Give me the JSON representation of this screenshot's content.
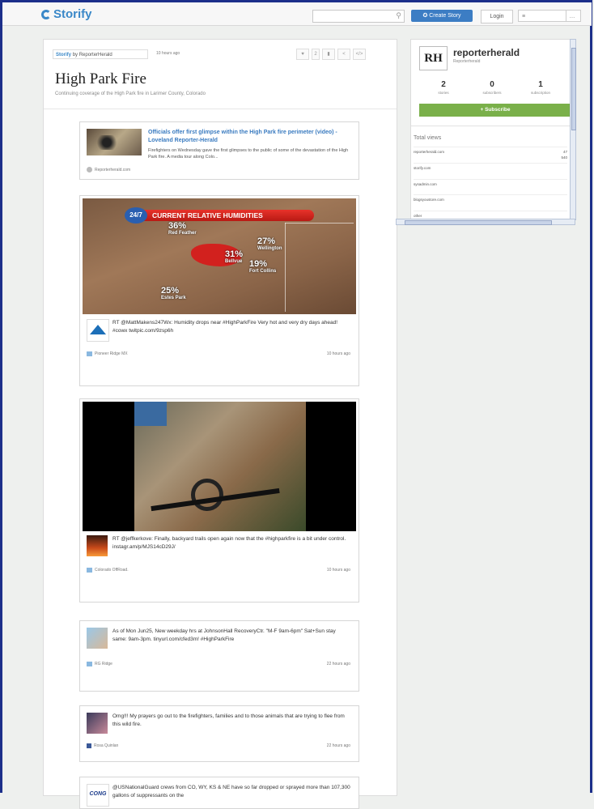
{
  "header": {
    "logo": "Storify",
    "search_placeholder": "",
    "create_label": "Create Story",
    "login_label": "Login",
    "lang_value": "≡"
  },
  "story": {
    "byline_brand": "Storify",
    "byline_by": "by ReporterHerald",
    "time_ago": "10 hours ago",
    "like_count": "2",
    "title": "High Park Fire",
    "subtitle": "Continuing coverage of the High Park fire in Larimer County, Colorado"
  },
  "cards": {
    "link": {
      "title": "Officials offer first glimpse within the High Park fire perimeter (video) - Loveland Reporter-Herald",
      "description": "Firefighters on Wednesday gave the first glimpses to the public of some of the devastation of the High Park fire. A media tour along Colo...",
      "source": "Reporterherald.com"
    },
    "map": {
      "banner": "CURRENT RELATIVE HUMIDITIES",
      "logo": "24/7",
      "labels": [
        {
          "n": "36%",
          "p": "Red Feather"
        },
        {
          "n": "27%",
          "p": "Wellington"
        },
        {
          "n": "31%",
          "p": "Bellvue"
        },
        {
          "n": "19%",
          "p": "Fort Collins"
        },
        {
          "n": "25%",
          "p": "Estes Park"
        }
      ]
    },
    "tweet1": {
      "text": "RT @MattMakens247Wx: Humidity drops near #HighParkFire Very hot and very dry days ahead! #cowx twitpic.com/9zsp6h",
      "author": "Pioneer Ridge MX",
      "time": "10 hours ago"
    },
    "tweet2": {
      "text": "RT @jeffkerkove: Finally, backyard trails open again now that the #highparkfire is a bit under control. instagr.am/p/MJS14cD29J/",
      "author": "Colorado OffRoad.",
      "time": "10 hours ago"
    },
    "tweet3": {
      "text": "As of Mon Jun25, New weekday hrs at JohnsonHall RecoveryCtr. \"M-F 9am-6pm\" Sat+Sun stay same: 9am-3pm. tinyurl.com/cfed3m! #HighParkFire",
      "author": "RG Ridge",
      "time": "22 hours ago"
    },
    "tweet4": {
      "text": "Omg!!! My prayers go out to the firefighters, families and to those animals that are trying to flee from this wild fire.",
      "author": "Rosa Quinlan",
      "time": "22 hours ago"
    },
    "tweet5": {
      "text": "@USNationalGuard crews from CO, WY, KS & NE have so far dropped or sprayed more than 107,300 gallons of suppressants on the",
      "avatar": "CONG"
    }
  },
  "sidebar": {
    "avatar": "RH",
    "name": "reporterherald",
    "sub": "Reporterherald",
    "stats": [
      {
        "n": "2",
        "l": "stories"
      },
      {
        "n": "0",
        "l": "subscribers"
      },
      {
        "n": "1",
        "l": "subscription"
      }
    ],
    "subscribe": "+ Subscribe",
    "views_title": "Total views",
    "views": [
      {
        "site": "reporterherald.com",
        "v": "47"
      },
      {
        "site": "",
        "v": "540"
      },
      {
        "site": "storify.com",
        "v": ""
      },
      {
        "site": "sysadmin.com",
        "v": ""
      },
      {
        "site": "blogsyoustore.com",
        "v": ""
      },
      {
        "site": "other",
        "v": ""
      }
    ]
  }
}
